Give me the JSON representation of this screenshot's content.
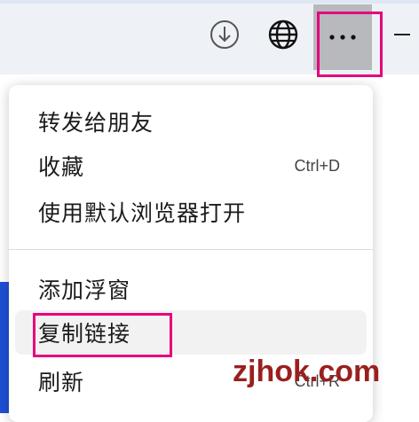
{
  "menu": {
    "items": [
      {
        "label": "转发给朋友",
        "shortcut": ""
      },
      {
        "label": "收藏",
        "shortcut": "Ctrl+D"
      },
      {
        "label": "使用默认浏览器打开",
        "shortcut": ""
      },
      {
        "label": "添加浮窗",
        "shortcut": ""
      },
      {
        "label": "复制链接",
        "shortcut": ""
      },
      {
        "label": "刷新",
        "shortcut": "Ctrl+R"
      }
    ]
  },
  "toolbar": {
    "icons": [
      "download-icon",
      "globe-icon",
      "more-icon",
      "minimize-icon"
    ]
  },
  "colors": {
    "highlight": "#e6007e",
    "toolbar_bg": "#eef1f6",
    "more_button_bg": "#b7b9bd",
    "hover_bg": "#f2f2f2",
    "watermark": "#9a1f1f"
  },
  "watermark": {
    "text": "zjhok.com"
  }
}
